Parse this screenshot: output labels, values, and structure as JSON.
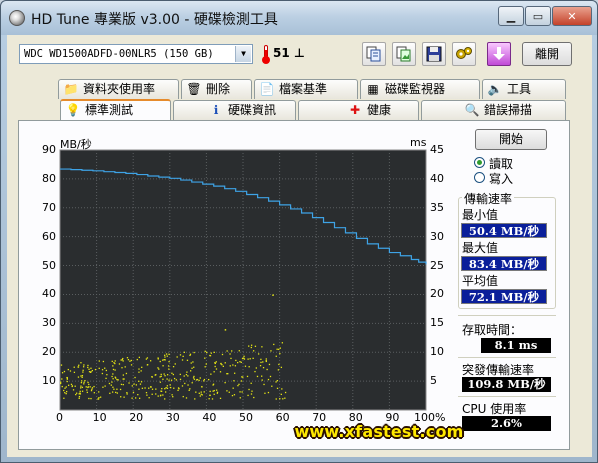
{
  "window": {
    "title": "HD Tune 專業版 v3.00 - 硬碟檢測工具",
    "minimize_glyph": "▁",
    "maximize_glyph": "▭",
    "close_glyph": "✕"
  },
  "toolbar": {
    "drive": "WDC WD1500ADFD-00NLR5 (150 GB)",
    "temperature": "51",
    "temperature_unit": "⊥",
    "exit_label": "離開",
    "icons": [
      "copy-text-icon",
      "copy-image-icon",
      "save-icon",
      "options-icon",
      "download-icon"
    ]
  },
  "tabs_top": [
    {
      "label": "資料夾使用率",
      "icon": "folder-icon",
      "glyph": "📁"
    },
    {
      "label": "刪除",
      "icon": "trash-icon",
      "glyph": "🗑"
    },
    {
      "label": "檔案基準",
      "icon": "file-benchmark-icon",
      "glyph": "📄"
    },
    {
      "label": "磁碟監視器",
      "icon": "disk-monitor-icon",
      "glyph": "▦"
    },
    {
      "label": "工具",
      "icon": "speaker-icon",
      "glyph": "🔈"
    }
  ],
  "tabs_bottom": [
    {
      "label": "標準測試",
      "icon": "lightbulb-icon",
      "glyph": "💡",
      "active": true
    },
    {
      "label": "硬碟資訊",
      "icon": "info-icon",
      "glyph": "ℹ",
      "active": false
    },
    {
      "label": "健康",
      "icon": "health-cross-icon",
      "glyph": "✚",
      "active": false
    },
    {
      "label": "錯誤掃描",
      "icon": "magnifier-icon",
      "glyph": "🔍",
      "active": false
    }
  ],
  "controls": {
    "start_label": "開始",
    "read_label": "讀取",
    "write_label": "寫入",
    "mode": "read"
  },
  "stats": {
    "transfer_rate_label": "傳輸速率",
    "min_label": "最小值",
    "min_value": "50.4 MB/秒",
    "max_label": "最大值",
    "max_value": "83.4 MB/秒",
    "avg_label": "平均值",
    "avg_value": "72.1 MB/秒",
    "access_time_label": "存取時間：",
    "access_time_value": "8.1 ms",
    "burst_label": "突發傳輸速率",
    "burst_value": "109.8 MB/秒",
    "cpu_label": "CPU 使用率",
    "cpu_value": "2.6%"
  },
  "chart_data": {
    "type": "line",
    "ylabel_left": "MB/秒",
    "ylabel_right": "ms",
    "xlim": [
      0,
      100
    ],
    "ylim_left": [
      0,
      90
    ],
    "ylim_right": [
      0,
      45
    ],
    "x_ticks": [
      "0",
      "10",
      "20",
      "30",
      "40",
      "50",
      "60",
      "70",
      "80",
      "90",
      "100%"
    ],
    "y_left_ticks": [
      "10",
      "20",
      "30",
      "40",
      "50",
      "60",
      "70",
      "80",
      "90"
    ],
    "y_right_ticks": [
      "5",
      "10",
      "15",
      "20",
      "25",
      "30",
      "35",
      "40",
      "45"
    ],
    "grid": true,
    "series": [
      {
        "type": "line",
        "color": "#3ea3e6",
        "x": [
          0,
          3,
          6,
          9,
          12,
          15,
          18,
          21,
          24,
          27,
          30,
          33,
          36,
          39,
          42,
          45,
          48,
          51,
          54,
          57,
          60,
          63,
          66,
          69,
          72,
          75,
          78,
          81,
          84,
          87,
          90,
          93,
          96,
          98,
          100
        ],
        "values": [
          83.4,
          83.2,
          83.0,
          82.8,
          82.5,
          82.2,
          81.9,
          81.5,
          81.0,
          80.6,
          80.2,
          79.6,
          78.9,
          78.2,
          77.5,
          76.6,
          75.7,
          74.6,
          73.5,
          72.3,
          71.0,
          69.6,
          68.2,
          66.6,
          64.9,
          63.1,
          61.3,
          59.4,
          57.5,
          56.0,
          54.5,
          53.4,
          52.1,
          51.2,
          50.4
        ]
      },
      {
        "type": "scatter",
        "color": "#e6e614",
        "axis": "right",
        "description_range_x": [
          0,
          62
        ],
        "values_range": [
          2,
          12
        ],
        "outliers": [
          {
            "x": 45,
            "y": 14
          },
          {
            "x": 58,
            "y": 20
          }
        ]
      }
    ]
  }
}
